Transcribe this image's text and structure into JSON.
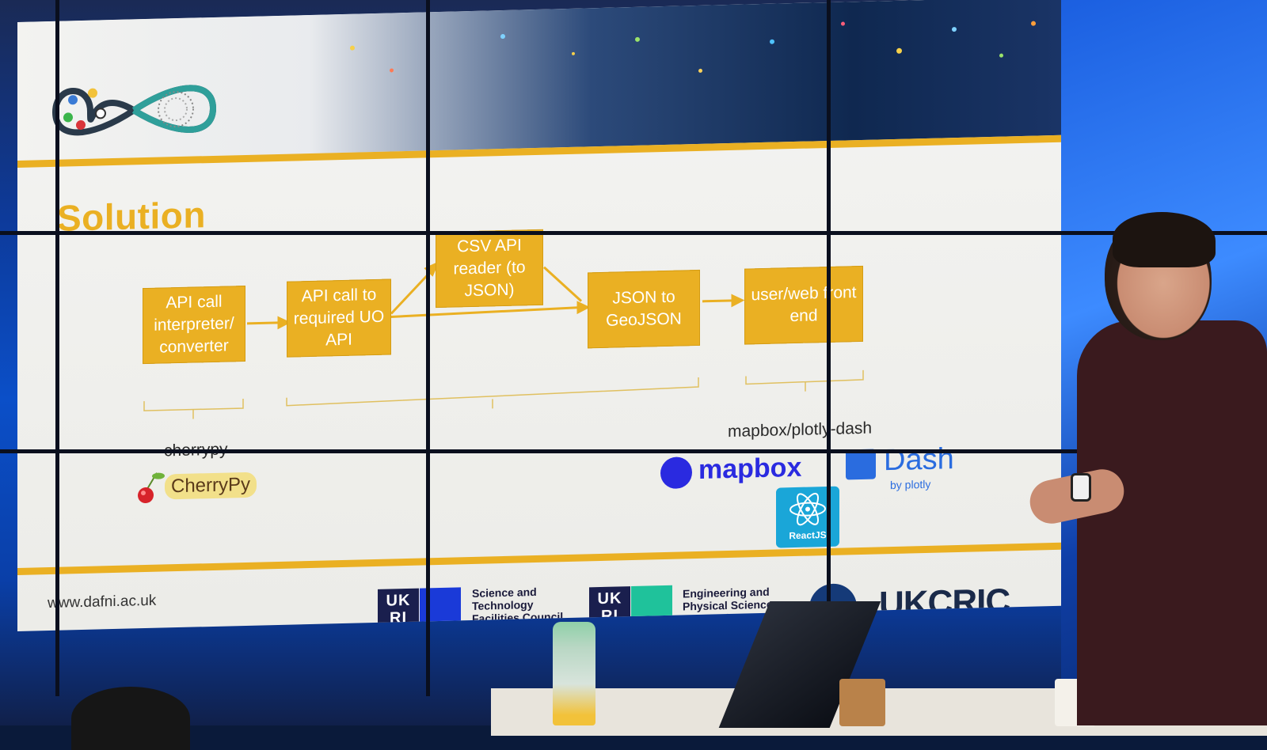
{
  "slide": {
    "title": "Solution",
    "url": "www.dafni.ac.uk",
    "boxes": {
      "b1": "API call interpreter/ converter",
      "b2": "API call to required UO API",
      "b3": "CSV API reader (to JSON)",
      "b4": "JSON to GeoJSON",
      "b5": "user/web front end"
    },
    "captions": {
      "cherrypy": "cherrypy",
      "mapbox_dash": "mapbox/plotly-dash"
    },
    "logos": {
      "cherrypy_logo": "CherryPy",
      "mapbox_logo": "mapbox",
      "dash_logo": "Dash",
      "dash_sub": "by plotly",
      "react_logo": "ReactJS"
    },
    "sponsors": {
      "ukri_mark": "UK RI",
      "stfc": "Science and Technology Facilities Council",
      "epsrc": "Engineering and Physical Sciences Research Council",
      "ukcric": "UKCRIC"
    }
  },
  "colors": {
    "gold": "#eab023",
    "ukri_navy": "#1a1f4e",
    "stfc_blue": "#1a3ad8",
    "epsrc_teal": "#1fc29b",
    "mapbox_blue": "#2a2ae0",
    "dash_blue": "#2a6cdf"
  }
}
